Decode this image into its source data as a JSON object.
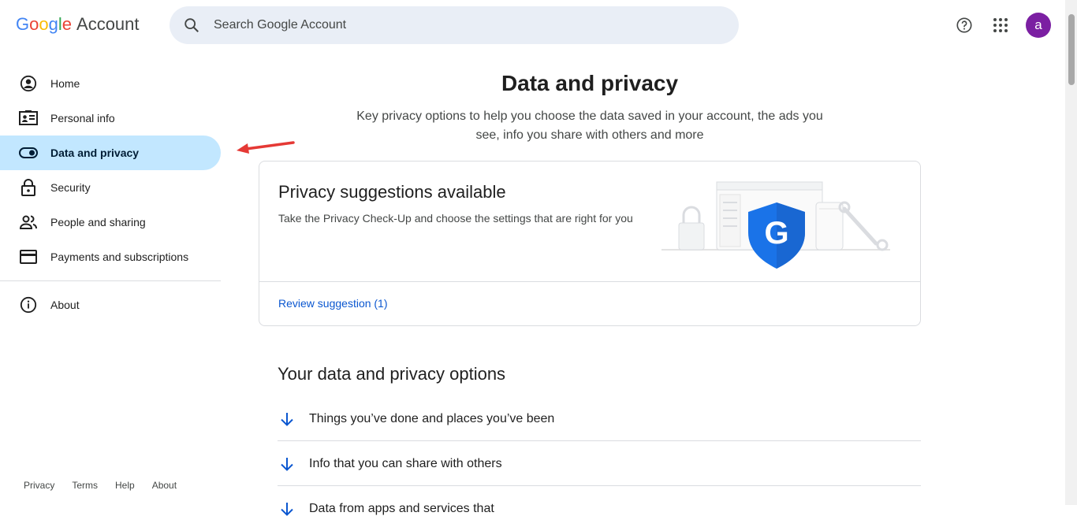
{
  "header": {
    "logo_letters": [
      "G",
      "o",
      "o",
      "g",
      "l",
      "e"
    ],
    "logo_suffix": "Account",
    "search_placeholder": "Search Google Account",
    "avatar_initial": "a"
  },
  "sidebar": {
    "items": [
      {
        "label": "Home",
        "icon": "account-circle-icon"
      },
      {
        "label": "Personal info",
        "icon": "id-card-icon"
      },
      {
        "label": "Data and privacy",
        "icon": "toggle-icon",
        "active": true
      },
      {
        "label": "Security",
        "icon": "lock-icon"
      },
      {
        "label": "People and sharing",
        "icon": "people-icon"
      },
      {
        "label": "Payments and subscriptions",
        "icon": "credit-card-icon"
      }
    ],
    "about": "About",
    "footer": [
      "Privacy",
      "Terms",
      "Help",
      "About"
    ]
  },
  "main": {
    "title": "Data and privacy",
    "subtitle": "Key privacy options to help you choose the data saved in your account, the ads you see, info you share with others and more",
    "card": {
      "title": "Privacy suggestions available",
      "text": "Take the Privacy Check-Up and choose the settings that are right for you",
      "link": "Review suggestion (1)"
    },
    "section_title": "Your data and privacy options",
    "options": [
      "Things you’ve done and places you’ve been",
      "Info that you can share with others",
      "Data from apps and services that"
    ]
  },
  "colors": {
    "active_bg": "#c2e7ff",
    "link": "#0b57d0",
    "avatar": "#7b1fa2",
    "annotation_arrow": "#e53935"
  }
}
